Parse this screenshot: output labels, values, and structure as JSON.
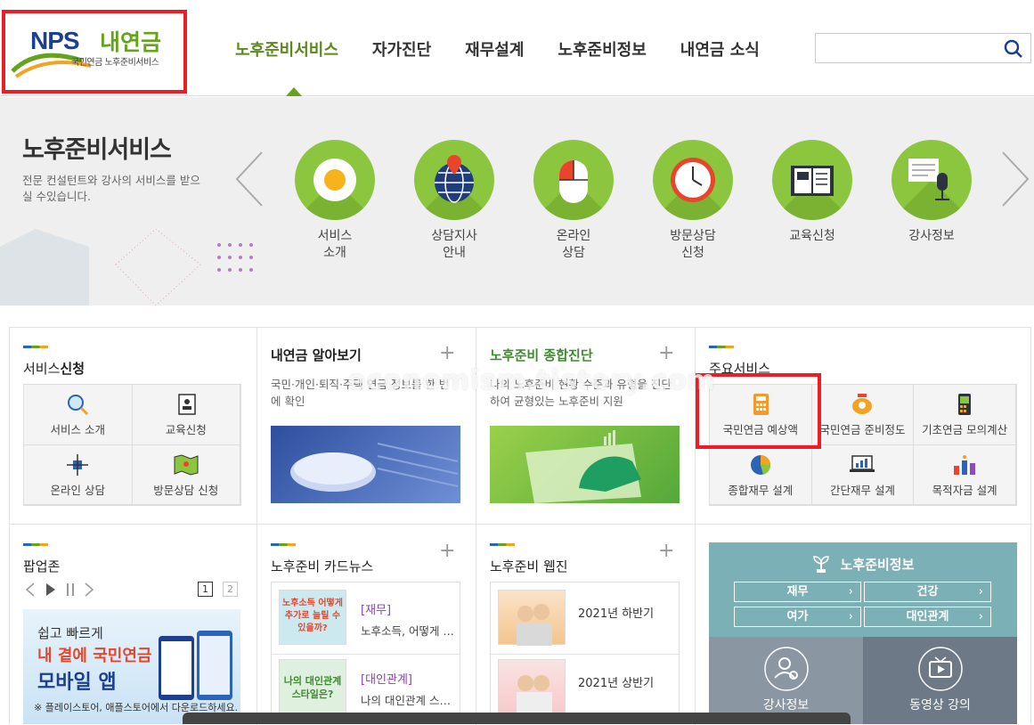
{
  "logo": {
    "nps": "NPS",
    "brand": "내연금",
    "sub": "국민연금 노후준비서비스"
  },
  "gnb": [
    "노후준비서비스",
    "자가진단",
    "재무설계",
    "노후준비정보",
    "내연금 소식"
  ],
  "search": {
    "placeholder": ""
  },
  "hero": {
    "title": "노후준비서비스",
    "desc": "전문 컨설턴트와 강사의 서비스를 받으실 수있습니다.",
    "services": [
      {
        "label": "서비스\n소개",
        "icon": "fried-egg-icon"
      },
      {
        "label": "상담지사\n안내",
        "icon": "globe-pin-icon"
      },
      {
        "label": "온라인\n상담",
        "icon": "mouse-icon"
      },
      {
        "label": "방문상담\n신청",
        "icon": "clock-icon"
      },
      {
        "label": "교육신청",
        "icon": "book-icon"
      },
      {
        "label": "강사정보",
        "icon": "microphone-icon"
      }
    ]
  },
  "boxes": {
    "apply": {
      "title_a": "서비스",
      "title_b": "신청",
      "tiles": [
        "서비스 소개",
        "교육신청",
        "온라인 상담",
        "방문상담 신청"
      ]
    },
    "mypension": {
      "title": "내연금 알아보기",
      "desc": "국민·개인·퇴직·주택 연금 정보를 한 번에 확인"
    },
    "diagnosis": {
      "title": "노후준비 종합진단",
      "desc": "나의 노후준비 현황 수준과 유형을 진단하여 균형있는 노후준비 지원"
    },
    "main": {
      "title_a": "주요",
      "title_b": "서비스",
      "tiles": [
        "국민연금 예상액",
        "국민연금 준비정도",
        "기초연금 모의계산",
        "종합재무 설계",
        "간단재무 설계",
        "목적자금 설계"
      ]
    },
    "popup": {
      "title_a": "팝업",
      "title_b": "존",
      "pages": [
        "1",
        "2"
      ],
      "banner_l1": "쉽고 빠르게",
      "banner_l2": "내 곁에 국민연금",
      "banner_l3": "모바일 앱",
      "banner_foot": "※ 플레이스토어, 애플스토어에서 다운로드하세요."
    },
    "cardnews": {
      "title_a": "노후준비 ",
      "title_b": "카드뉴스",
      "items": [
        {
          "cat": "[재무]",
          "text": "노후소득, 어떻게 …",
          "thumb": "노후소득 어떻게 추가로 늘릴 수 있을까?"
        },
        {
          "cat": "[대인관계]",
          "text": "나의 대인관계 스…",
          "thumb": "나의 대인관계 스타일은?"
        }
      ]
    },
    "webzine": {
      "title_a": "노후준비 ",
      "title_b": "웹진",
      "items": [
        "2021년 하반기",
        "2021년 상반기"
      ]
    },
    "info": {
      "title": "노후준비정보",
      "buttons": [
        "재무",
        "건강",
        "여가",
        "대인관계"
      ],
      "cells": [
        "강사정보",
        "동영상 강의"
      ]
    }
  },
  "watermark": "economism.tistory.com",
  "colors": {
    "green": "#8cc63f",
    "navy": "#1d3f8f",
    "highlight": "#ee1c25",
    "teal": "#7bb0b6"
  }
}
